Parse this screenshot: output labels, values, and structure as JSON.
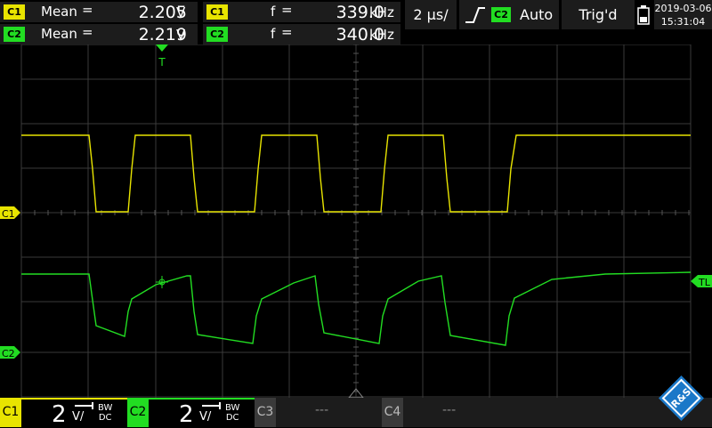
{
  "measurements": [
    {
      "tag": "C1",
      "name": "Mean",
      "eq": "=",
      "value": "2.205",
      "unit": "V",
      "color": "#e8e400"
    },
    {
      "tag": "C2",
      "name": "Mean",
      "eq": "=",
      "value": "2.219",
      "unit": "V",
      "color": "#22dd22"
    },
    {
      "tag": "C1",
      "name": "f",
      "eq": "=",
      "value": "339.0",
      "unit": "kHz",
      "color": "#e8e400"
    },
    {
      "tag": "C2",
      "name": "f",
      "eq": "=",
      "value": "340.0",
      "unit": "kHz",
      "color": "#22dd22"
    }
  ],
  "timebase": "2 µs/",
  "trigger": {
    "source": "C2",
    "mode": "Auto",
    "status": "Trig'd"
  },
  "datetime": {
    "date": "2019-03-06",
    "time": "15:31:04"
  },
  "markers": {
    "trigger": "T",
    "c1": "C1",
    "c2": "C2",
    "trigger_level": "TL"
  },
  "channels": [
    {
      "tag": "C1",
      "scale": "2",
      "unit": "V/",
      "bw": "BW",
      "coupling": "DC",
      "color": "#e8e400"
    },
    {
      "tag": "C2",
      "scale": "2",
      "unit": "V/",
      "bw": "BW",
      "coupling": "DC",
      "color": "#22dd22"
    },
    {
      "tag": "C3",
      "scale": "---",
      "color": "#555555"
    },
    {
      "tag": "C4",
      "scale": "---",
      "color": "#555555"
    }
  ],
  "logo_text": "R&S",
  "colors": {
    "c1": "#e8e400",
    "c2": "#22dd22",
    "grid": "#444444",
    "panel": "#1c1c1c"
  }
}
